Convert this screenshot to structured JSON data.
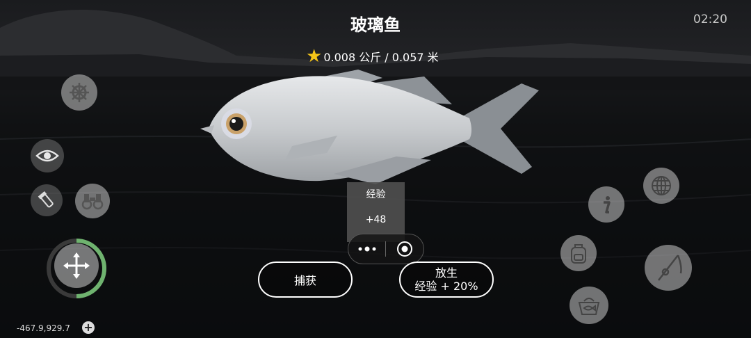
{
  "header": {
    "fish_name": "玻璃鱼",
    "clock": "02:20"
  },
  "catch_stats": {
    "text": "0.008 公斤 / 0.057 米",
    "star_color": "#f5c518"
  },
  "tooltip": {
    "label": "经验",
    "value": "+48"
  },
  "actions": {
    "keep_label": "捕获",
    "release_label": "放生",
    "release_bonus": "经验 + 20%"
  },
  "hud": {
    "coordinates": "-467.9,929.7",
    "joystick_ring_color": "#6fb36f"
  },
  "icons": {
    "left": [
      "ship-wheel-icon",
      "eye-icon",
      "flashlight-icon",
      "binoculars-icon",
      "move-arrows-icon"
    ],
    "right": [
      "globe-icon",
      "info-icon",
      "backpack-icon",
      "fishing-rod-icon",
      "fish-basket-icon"
    ]
  }
}
